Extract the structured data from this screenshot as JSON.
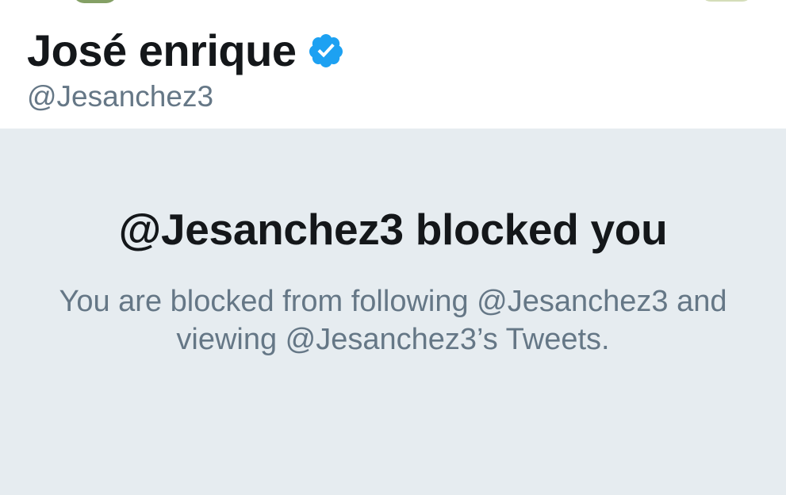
{
  "profile": {
    "display_name": "José enrique",
    "handle": "@Jesanchez3",
    "verified": true,
    "verified_icon": "verified-badge-icon"
  },
  "blocked": {
    "title": "@Jesanchez3 blocked you",
    "description": "You are blocked from following @Jesanchez3 and viewing @Jesanchez3’s Tweets."
  },
  "colors": {
    "primary_text": "#14171a",
    "secondary_text": "#657786",
    "panel_background": "#e6ecf0",
    "verified_blue": "#1da1f2"
  }
}
